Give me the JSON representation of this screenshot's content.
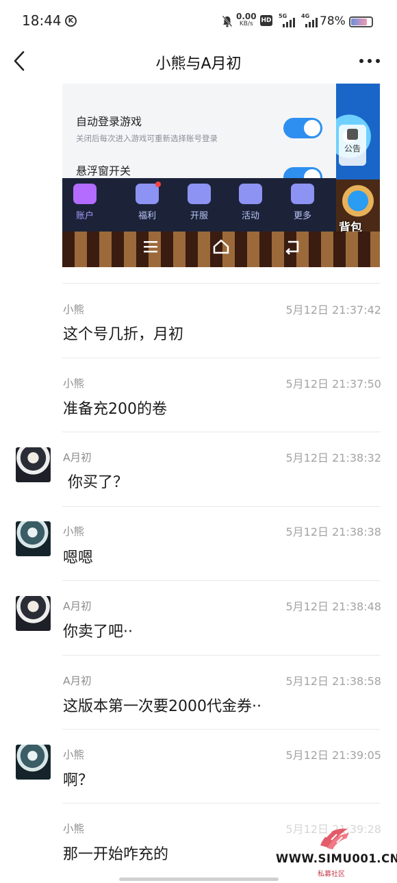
{
  "status_bar": {
    "time": "18:44",
    "k_badge": "K",
    "net_speed_value": "0.00",
    "net_speed_unit": "KB/s",
    "hd_label": "HD",
    "sim1_label": "5G",
    "sim2_label": "4G",
    "battery_pct": "78%",
    "battery_level": 0.78
  },
  "header": {
    "title": "小熊与A月初",
    "back_icon": "chevron-left-icon",
    "more_icon": "more-dots-icon"
  },
  "game_screenshot": {
    "auto_login_label": "自动登录游戏",
    "auto_login_desc": "关闭后每次进入游戏可重新选择账号登录",
    "auto_login_on": true,
    "float_window_label": "悬浮窗开关",
    "float_window_on": true,
    "notice_label": "公告",
    "bag_label": "背包",
    "nav": [
      {
        "label": "账户",
        "icon": "smiley-icon",
        "active": true,
        "badge": false
      },
      {
        "label": "福利",
        "icon": "gift-icon",
        "active": false,
        "badge": true
      },
      {
        "label": "开服",
        "icon": "gamepad-icon",
        "active": false,
        "badge": false
      },
      {
        "label": "活动",
        "icon": "controller-icon",
        "active": false,
        "badge": false
      },
      {
        "label": "更多",
        "icon": "grid-icon",
        "active": false,
        "badge": false
      }
    ]
  },
  "messages": [
    {
      "sender": "小熊",
      "time": "5月12日 21:37:42",
      "text": "这个号几折，月初",
      "avatar": ""
    },
    {
      "sender": "小熊",
      "time": "5月12日 21:37:50",
      "text": "准备充200的卷",
      "avatar": ""
    },
    {
      "sender": "A月初",
      "time": "5月12日 21:38:32",
      "text": " 你买了？",
      "avatar": "a"
    },
    {
      "sender": "小熊",
      "time": "5月12日 21:38:38",
      "text": "嗯嗯",
      "avatar": "b"
    },
    {
      "sender": "A月初",
      "time": "5月12日 21:38:48",
      "text": "你卖了吧··",
      "avatar": "a"
    },
    {
      "sender": "A月初",
      "time": "5月12日 21:38:58",
      "text": "这版本第一次要2000代金券··",
      "avatar": ""
    },
    {
      "sender": "小熊",
      "time": "5月12日 21:39:05",
      "text": "啊？",
      "avatar": "b"
    },
    {
      "sender": "小熊",
      "time": "5月12日 21:39:28",
      "text": "那一开始咋充的",
      "avatar": ""
    }
  ],
  "watermark": {
    "text": "WWW.SIMU001.CN",
    "sub": "私募社区"
  }
}
